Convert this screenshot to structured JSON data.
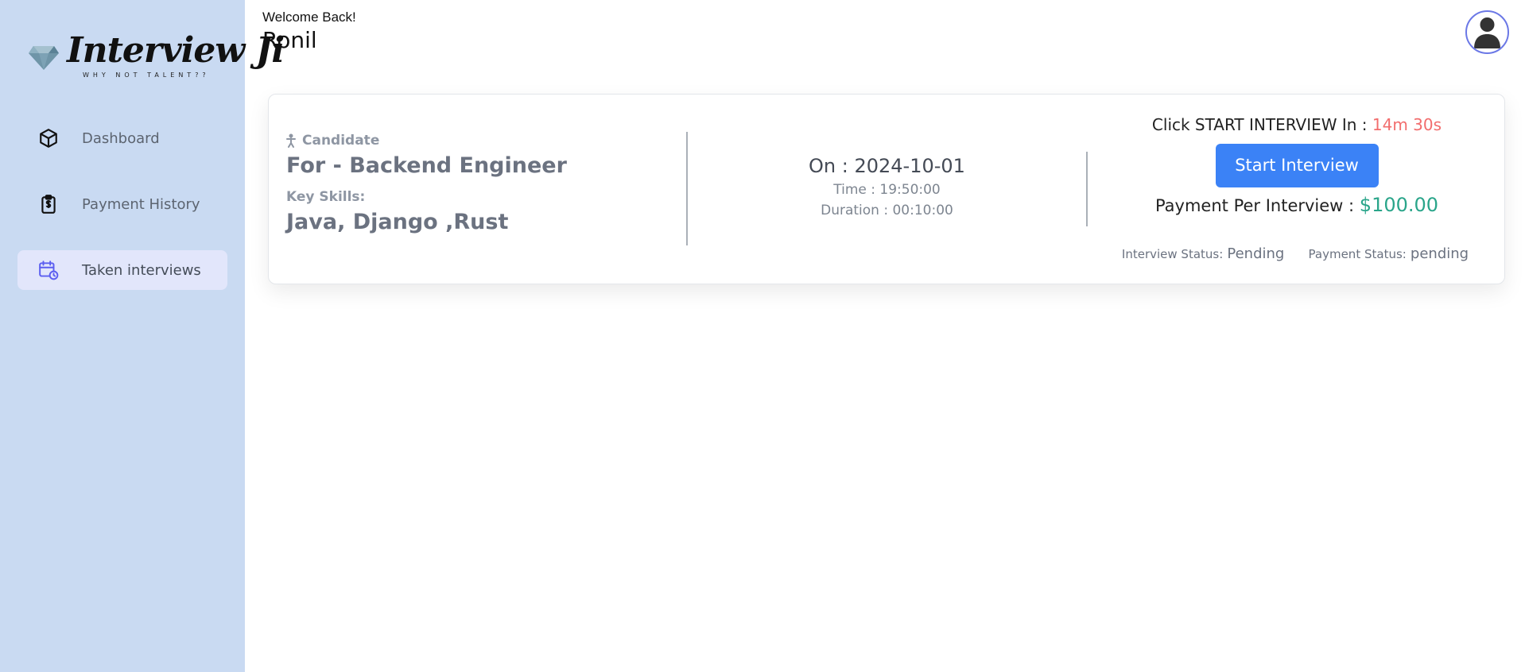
{
  "brand": {
    "name": "Interview Ji",
    "tagline": "WHY NOT TALENT??"
  },
  "sidebar": {
    "items": [
      {
        "label": "Dashboard",
        "icon": "cube-icon",
        "active": false
      },
      {
        "label": "Payment History",
        "icon": "clipboard-dollar-icon",
        "active": false
      },
      {
        "label": "Taken interviews",
        "icon": "calendar-clock-icon",
        "active": true
      }
    ]
  },
  "header": {
    "welcome": "Welcome Back!",
    "username": "Ronil",
    "avatar_icon": "user-avatar-icon"
  },
  "interview": {
    "candidate_label": "Candidate",
    "role": "For - Backend Engineer",
    "skills_label": "Key Skills:",
    "skills": "Java, Django ,Rust",
    "date": "On : 2024-10-01",
    "time": "Time : 19:50:00",
    "duration": "Duration : 00:10:00",
    "start_prompt": "Click START INTERVIEW In : ",
    "countdown": "14m 30s",
    "start_button": "Start Interview",
    "payment_label": "Payment Per Interview : ",
    "payment_amount": "$100.00",
    "interview_status_label": "Interview Status:",
    "interview_status": "Pending",
    "payment_status_label": "Payment Status:",
    "payment_status": "pending"
  },
  "colors": {
    "sidebar_bg": "#c9daf2",
    "active_item_bg": "#e2e6fb",
    "accent": "#3b82f6",
    "countdown": "#f26d6d",
    "amount": "#2aa58a"
  }
}
